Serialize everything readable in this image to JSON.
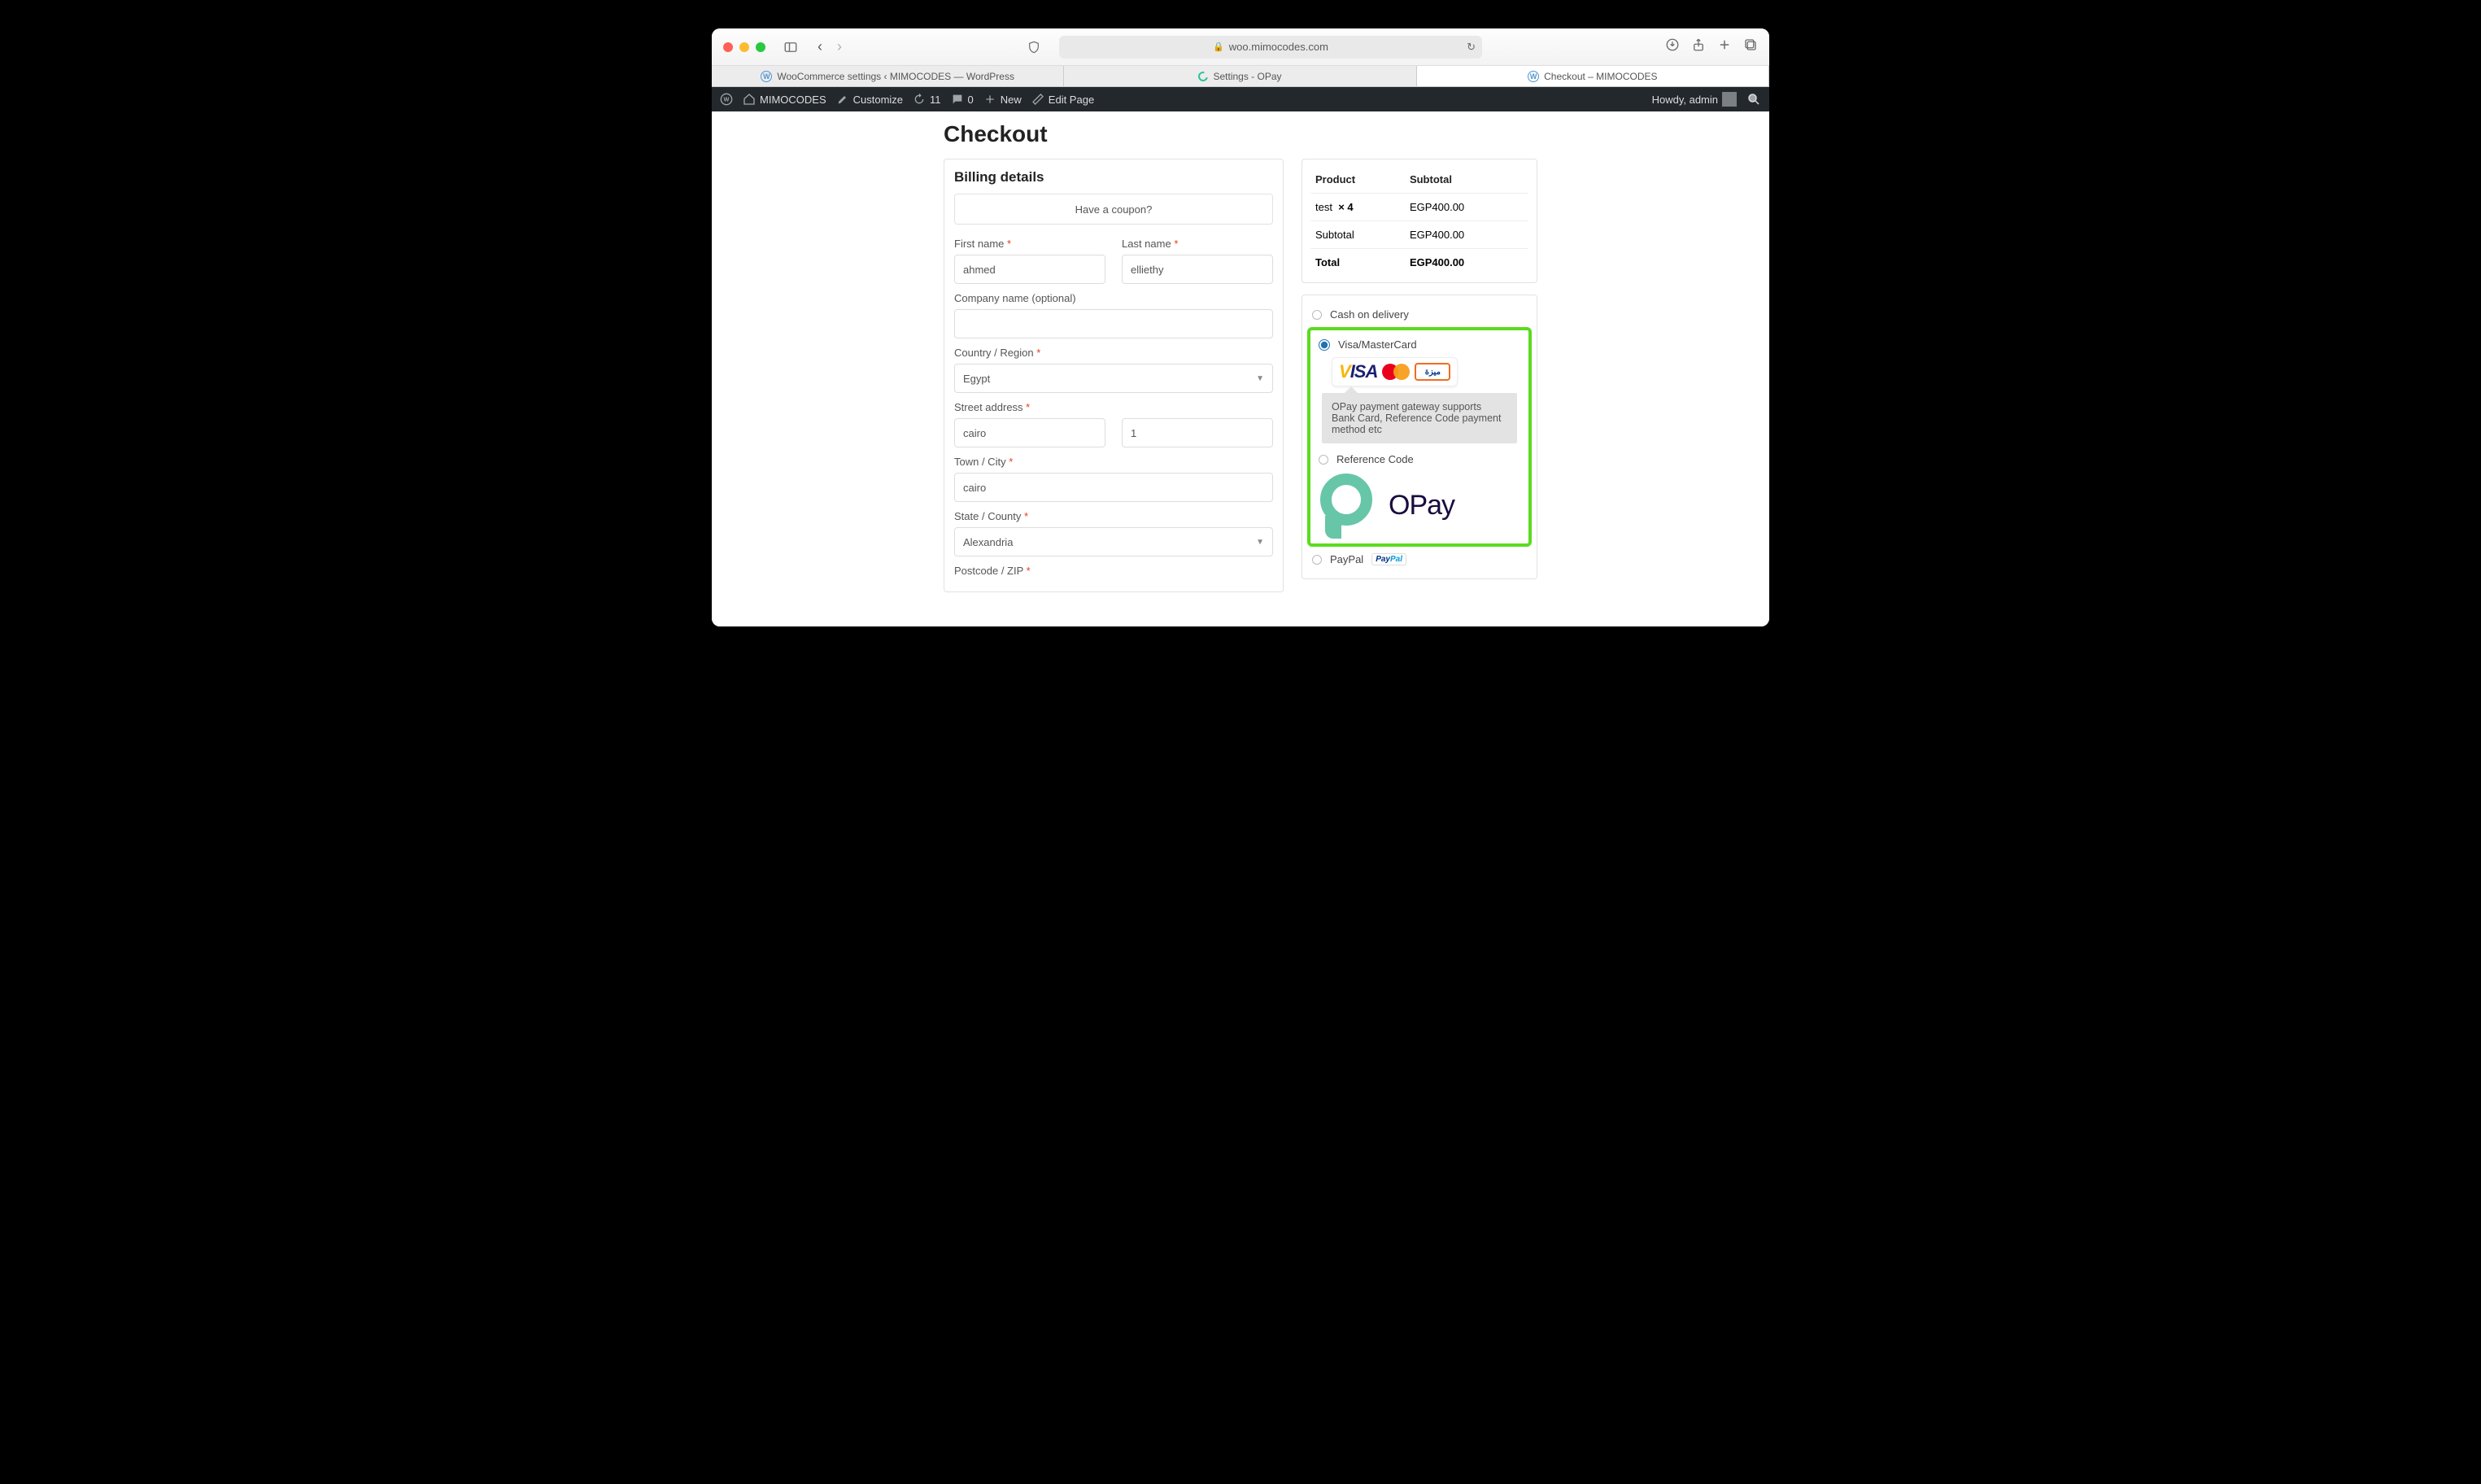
{
  "browser": {
    "url": "woo.mimocodes.com",
    "tabs": [
      {
        "label": "WooCommerce settings ‹ MIMOCODES — WordPress",
        "favicon": "wp"
      },
      {
        "label": "Settings - OPay",
        "favicon": "opay"
      },
      {
        "label": "Checkout – MIMOCODES",
        "favicon": "wp"
      }
    ],
    "activeTab": 2
  },
  "adminbar": {
    "site": "MIMOCODES",
    "customize": "Customize",
    "updates": "11",
    "comments": "0",
    "new": "New",
    "edit": "Edit Page",
    "howdy": "Howdy, admin"
  },
  "page": {
    "title": "Checkout",
    "billing": {
      "heading": "Billing details",
      "coupon": "Have a coupon?",
      "fields": {
        "first_name": {
          "label": "First name",
          "value": "ahmed",
          "required": true
        },
        "last_name": {
          "label": "Last name",
          "value": "elliethy",
          "required": true
        },
        "company": {
          "label": "Company name (optional)",
          "value": "",
          "required": false
        },
        "country": {
          "label": "Country / Region",
          "value": "Egypt",
          "required": true
        },
        "street": {
          "label": "Street address",
          "value1": "cairo",
          "value2": "1",
          "required": true
        },
        "city": {
          "label": "Town / City",
          "value": "cairo",
          "required": true
        },
        "state": {
          "label": "State / County",
          "value": "Alexandria",
          "required": true
        },
        "postcode": {
          "label": "Postcode / ZIP",
          "required": true
        }
      }
    },
    "order": {
      "head_product": "Product",
      "head_subtotal": "Subtotal",
      "rows": [
        {
          "name": "test",
          "qty": "× 4",
          "total": "EGP400.00"
        }
      ],
      "subtotal_label": "Subtotal",
      "subtotal": "EGP400.00",
      "total_label": "Total",
      "total": "EGP400.00"
    },
    "payment": {
      "cod": "Cash on delivery",
      "visa": "Visa/MasterCard",
      "visa_desc": "OPay payment gateway supports Bank Card, Reference Code payment method etc",
      "ref": "Reference Code",
      "opay_word": "OPay",
      "paypal": "PayPal"
    }
  }
}
